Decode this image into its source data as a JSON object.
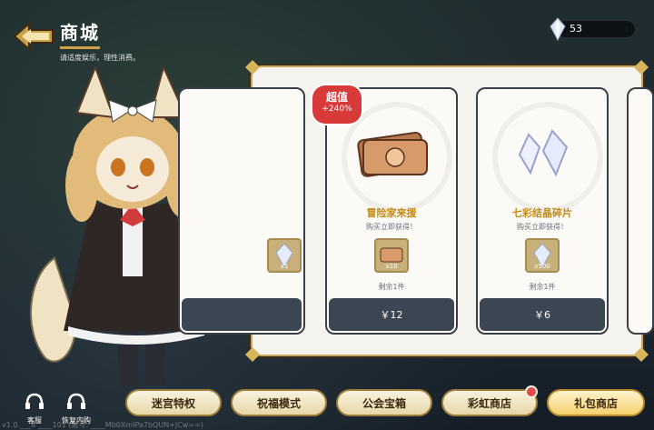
{
  "header": {
    "title": "商城",
    "subtitle": "请适度娱乐，理性消费。"
  },
  "currency": {
    "icon": "crystal-icon",
    "value": "53"
  },
  "cards": [
    {
      "title": "冒险家来援",
      "hint": "购买立即获得！",
      "reward_count": "x10",
      "remaining": "剩余1件",
      "price": "￥12",
      "badge_title": "超值",
      "badge_value": "+240%"
    },
    {
      "title": "七彩结晶碎片",
      "hint": "购买立即获得！",
      "reward_count": "x500",
      "remaining": "剩余1件",
      "price": "￥6"
    }
  ],
  "partial_card": {
    "reward_count": "x1"
  },
  "nav": {
    "items": [
      "迷宫特权",
      "祝福模式",
      "公会宝箱",
      "彩虹商店",
      "礼包商店"
    ]
  },
  "tools": {
    "support": "客服",
    "restore": "恢复内购"
  },
  "version_text": "v1.0.___8 ____101 (账号: ____Mb0XmIPa7bQUN+JCw==)",
  "colors": {
    "accent": "#cfa24a",
    "badge": "#d83a3a",
    "button": "#3c4652"
  }
}
